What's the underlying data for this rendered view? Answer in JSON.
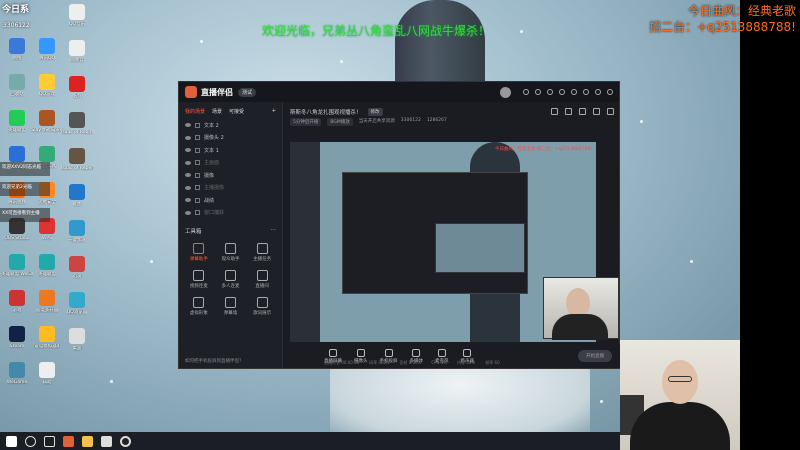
{
  "overlay": {
    "corner_logo": "今日系",
    "corner_id": "3306122",
    "banner_green": "欢迎光临，兄弟丛八角蛮乱八网战牛爆杀！",
    "banner_orange_1": "今日曲风：经典老歌",
    "banner_orange_2": "招二台：+q2513888788!"
  },
  "desktop": {
    "col1": [
      "网络",
      "回收站",
      "英雄联盟",
      "电脑管家",
      "腾讯视频",
      "OBS Studio",
      "英雄联盟 WeGame版",
      "游戏",
      "Steam",
      "WeGame"
    ],
    "col2": [
      "腾讯QQ",
      "QQ游戏",
      "Slay the Spire",
      "优化工具",
      "火绒安全",
      "WPS",
      "英雄联盟",
      "雷电多开器",
      "雷电模拟器4",
      "辅助"
    ],
    "col3": [
      "QQ音乐",
      "网易云",
      "酷狗",
      "Isaac of Rebirth",
      "Isaac of Repentance",
      "截图",
      "一键加速",
      "迅雷",
      "QQ浏览器",
      "桌面"
    ],
    "side_notes": [
      "欢迎XXV2同志光临",
      "欢迎兄弟2光临",
      "XX可直接看到主播"
    ]
  },
  "app": {
    "title": "直播伴侣",
    "version": "测试",
    "tabs": [
      "我的场景",
      "场景",
      "可接受"
    ],
    "layers": [
      {
        "label": "文本 2",
        "dim": false
      },
      {
        "label": "摄像头 2",
        "dim": false
      },
      {
        "label": "文本 1",
        "dim": false
      },
      {
        "label": "主画面",
        "dim": true
      },
      {
        "label": "摄像",
        "dim": false
      },
      {
        "label": "主播摄像",
        "dim": true
      },
      {
        "label": "战绩",
        "dim": false
      },
      {
        "label": "窗口捕获",
        "dim": true
      }
    ],
    "tools_title": "工具箱",
    "tools": [
      {
        "label": "弹幕助手",
        "hot": true
      },
      {
        "label": "观众助手",
        "hot": false
      },
      {
        "label": "主播任务",
        "hot": false
      },
      {
        "label": "视频连麦",
        "hot": false
      },
      {
        "label": "多人连麦",
        "hot": false
      },
      {
        "label": "直播间",
        "hot": false
      },
      {
        "label": "虚拟形象",
        "hot": false
      },
      {
        "label": "弹幕墙",
        "hot": false
      },
      {
        "label": "歌词展示",
        "hot": false
      }
    ],
    "footer_hint": "如何把手机投屏到直播伴侣？",
    "room_title": "斯斯冬八角龙扎围观视播杀！",
    "room_badge": "修改",
    "info": [
      "5分钟后开播",
      "BGM播放",
      "当天开启共享资源",
      "3306122",
      "1286267"
    ],
    "preview_red": "今日曲风：经典老歌 招二台：+q2513888788!",
    "bottom_tools": [
      "直播屏幕",
      "摄像头",
      "手机投屏",
      "多媒体",
      "麦克风",
      "扬声器"
    ],
    "start_live": "开始直播",
    "status": [
      "直播时长 00:00:00",
      "码率 0kb/s",
      "丢帧 0.00%",
      "CPU 4%",
      "内存 40%",
      "帧率 60"
    ]
  },
  "taskbar": {
    "icons": [
      "windows-logo",
      "search",
      "task-view",
      "live-companion",
      "file-explorer",
      "streaming-tool",
      "obs"
    ]
  }
}
